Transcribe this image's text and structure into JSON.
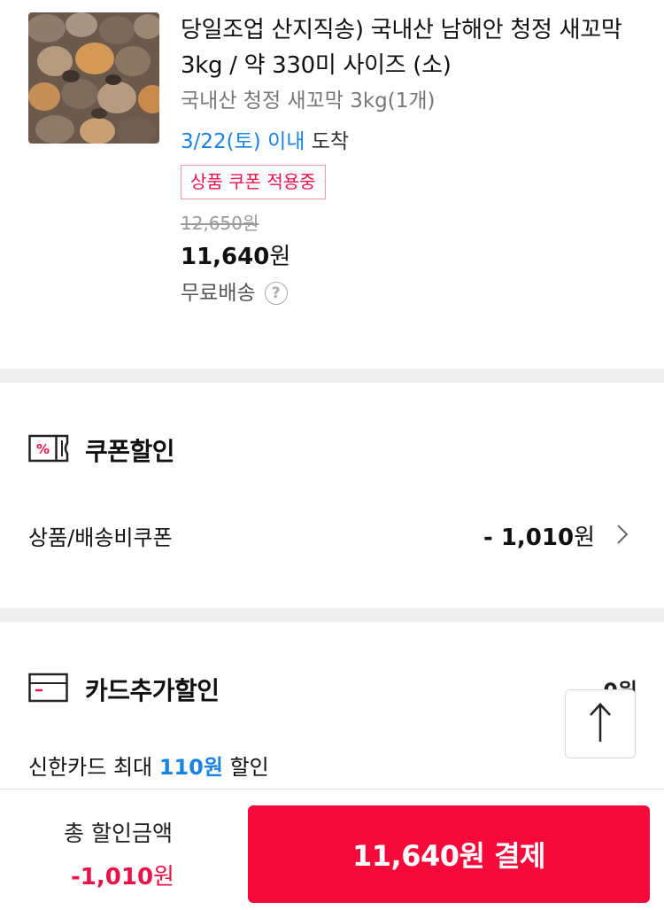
{
  "product": {
    "title": "당일조업 산지직송) 국내산 남해안 청정 새꼬막 3kg / 약 330미 사이즈 (소)",
    "option": "국내산 청정 새꼬막 3kg(1개)",
    "delivery_date": "3/22(토) 이내",
    "delivery_suffix": "도착",
    "coupon_badge": "상품 쿠폰 적용중",
    "original_price": "12,650원",
    "final_price_num": "11,640",
    "final_price_unit": "원",
    "shipping": "무료배송"
  },
  "coupon_section": {
    "title": "쿠폰할인",
    "row_label": "상품/배송비쿠폰",
    "row_value_num": "- 1,010",
    "row_value_unit": "원"
  },
  "card_section": {
    "title": "카드추가할인",
    "value": "0원",
    "sub_prefix": "신한카드 최대 ",
    "sub_amount": "110원",
    "sub_suffix": " 할인"
  },
  "bottom_bar": {
    "total_label": "총 할인금액",
    "total_amount_num": "-1,010",
    "total_amount_unit": "원",
    "pay_button": "11,640원 결제"
  },
  "colors": {
    "accent_red": "#f5083a",
    "discount_red": "#e8134a",
    "link_blue": "#1a82e0"
  },
  "icons": {
    "coupon": "percent-coupon-icon",
    "card": "credit-card-icon",
    "help": "question-circle-icon",
    "chevron": "chevron-right-icon",
    "scroll_top": "arrow-up-icon"
  }
}
